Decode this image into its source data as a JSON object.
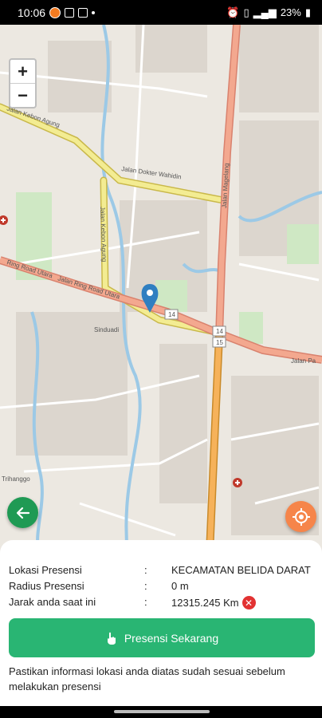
{
  "status_bar": {
    "time": "10:06",
    "battery": "23%"
  },
  "map": {
    "zoom_in": "+",
    "zoom_out": "−",
    "labels": {
      "kebon_agung": "Jalan Kebon Agung",
      "dokter_wahidin": "Jalan Dokter Wahidin",
      "magelang": "Jalan Magelang",
      "ring_road": "Ring Road Utara",
      "ring_road_jalan": "Jalan Ring Road Utara",
      "kebon_agung_v": "Jalan Kebon Agung",
      "sinduadi": "Sinduadi",
      "jalan_pa": "Jalan Pa",
      "trihanggo": "Trihanggo",
      "shield_14a": "14",
      "shield_14b": "14",
      "shield_15": "15"
    }
  },
  "panel": {
    "rows": [
      {
        "label": "Lokasi Presensi",
        "sep": ":",
        "value": "KECAMATAN BELIDA DARAT"
      },
      {
        "label": "Radius Presensi",
        "sep": ":",
        "value": "0 m"
      },
      {
        "label": "Jarak anda saat ini",
        "sep": ":",
        "value": "12315.245 Km"
      }
    ],
    "button_label": "Presensi Sekarang",
    "info_text": "Pastikan informasi lokasi anda diatas sudah sesuai sebelum melakukan presensi"
  }
}
